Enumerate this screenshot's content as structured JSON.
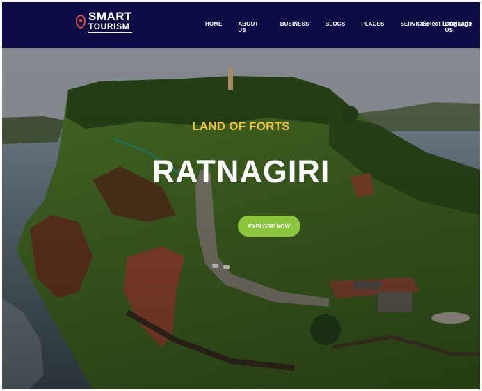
{
  "brand": {
    "line1": "SMART",
    "line2": "TOURISM"
  },
  "nav": {
    "items": [
      "HOME",
      "ABOUT US",
      "BUSINESS",
      "BLOGS",
      "PLACES",
      "SERVICES",
      "CONTACT US"
    ],
    "language": "Select Language"
  },
  "hero": {
    "tagline": "LAND OF FORTS",
    "title": "RATNAGIRI",
    "cta": "EXPLORE NOW"
  },
  "colors": {
    "navbar": "#0d0b47",
    "tagline": "#f2c53d",
    "cta": "#8cc63f",
    "logo_accent": "#e0513f"
  }
}
